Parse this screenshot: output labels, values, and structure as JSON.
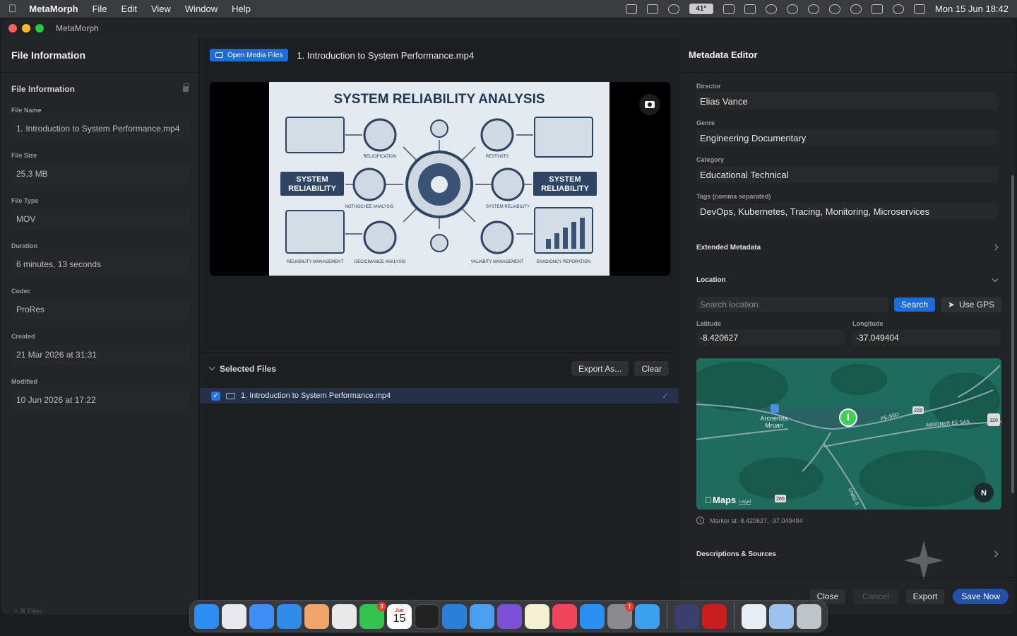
{
  "menubar": {
    "app_name": "MetaMorph",
    "items": [
      "File",
      "Edit",
      "View",
      "Window",
      "Help"
    ],
    "temp_badge": "41°",
    "datetime": "Mon 15 Jun  18:42"
  },
  "window": {
    "title": "MetaMorph"
  },
  "sidebar": {
    "header": "File Information",
    "section": "File Information",
    "fields": [
      {
        "label": "File Name",
        "value": "1. Introduction to System Performance.mp4"
      },
      {
        "label": "File Size",
        "value": "25,3 MB"
      },
      {
        "label": "File Type",
        "value": "MOV"
      },
      {
        "label": "Duration",
        "value": "6 minutes, 13 seconds"
      },
      {
        "label": "Codec",
        "value": "ProRes"
      },
      {
        "label": "Created",
        "value": "21 Mar 2026 at 31:31"
      },
      {
        "label": "Modified",
        "value": "10 Jun 2026 at 17:22"
      }
    ],
    "footer_hint": "+  ⌘  Filter"
  },
  "center": {
    "open_button": "Open Media Files",
    "file_title": "1. Introduction to System Performance.mp4",
    "video": {
      "title": "SYSTEM RELIABILITY ANALYSIS",
      "left_box": "SYSTEM\nRELIABILITY",
      "right_box": "SYSTEM\nRELIABILITY",
      "labels": [
        "RELICIFICATION",
        "RESTVOTS",
        "NOTHOCHEE ANALYSIS",
        "SYSTEM RELIABILITY",
        "RELIABILITY MANAGEMENT",
        "DECICIMANCE ANALYSIS",
        "VALIABITY MANAGEMENT",
        "ENADIONCY REPORATION"
      ]
    },
    "selected_files_title": "Selected Files",
    "export_as": "Export As...",
    "clear": "Clear",
    "files": [
      "1. Introduction to System Performance.mp4"
    ]
  },
  "metadata": {
    "header": "Metadata Editor",
    "fields": [
      {
        "label": "Director",
        "value": "Elias Vance"
      },
      {
        "label": "Genre",
        "value": "Engineering Documentary"
      },
      {
        "label": "Category",
        "value": "Educational Technical"
      },
      {
        "label": "Tags (comma separated)",
        "value": "DevOps, Kubernetes, Tracing, Monitoring, Microservices"
      }
    ],
    "extended": "Extended Metadata",
    "location": "Location",
    "search_placeholder": "Search location",
    "search_btn": "Search",
    "gps_btn": "Use GPS",
    "lat_label": "Latitude",
    "lat_value": "-8.420627",
    "lon_label": "Longitude",
    "lon_value": "-37.049404",
    "map": {
      "place": "Arcnerbta\nMruari",
      "road1": "PE-SSD",
      "road2": "ABDONER-EE SAS",
      "shield1": "228",
      "shield2": "320",
      "shield3": "265",
      "road3": "UNEE-9",
      "maps_brand": "Maps",
      "legal": "Legal",
      "compass": "N"
    },
    "marker_note": "Marker at -8.420627, -37.049494",
    "descriptions": "Descriptions & Sources",
    "close": "Close",
    "cancel": "Cancel",
    "export": "Export",
    "save": "Save Now"
  },
  "dock": {
    "calendar_month": "Jun",
    "calendar_day": "15",
    "messages_badge": "3",
    "settings_badge": "1"
  },
  "colors": {
    "accent": "#1e6bdc",
    "save": "#2351a8",
    "map_green": "#1d6a5e",
    "pin": "#3fcf5a"
  }
}
